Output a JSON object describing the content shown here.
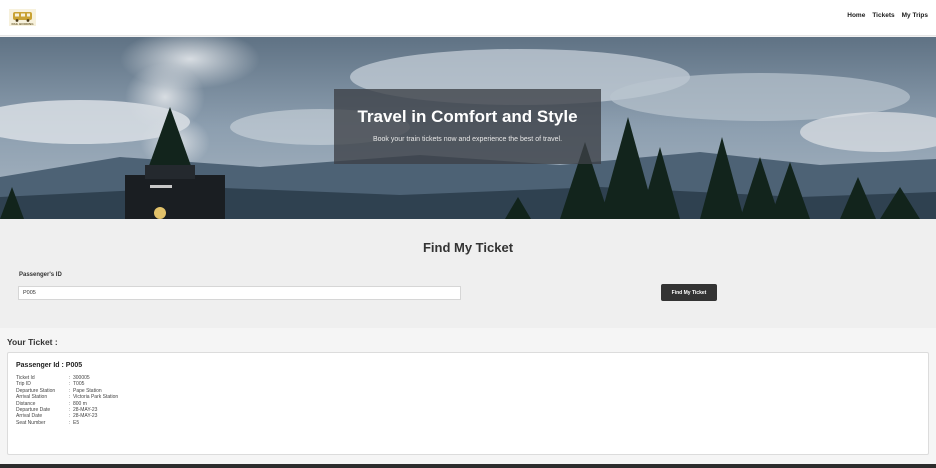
{
  "logo": {
    "text": "RAIL BOOKING",
    "icon": "train-logo-icon"
  },
  "nav": {
    "items": [
      "Home",
      "Tickets",
      "My Trips"
    ]
  },
  "hero": {
    "title": "Travel in Comfort and Style",
    "subtitle": "Book your train tickets now and experience the best of travel."
  },
  "find": {
    "title": "Find My Ticket",
    "label": "Passenger's ID",
    "input_value": "P005",
    "button_label": "Find My Ticket"
  },
  "ticket": {
    "heading": "Your Ticket :",
    "passenger_line": "Passenger Id : P005",
    "rows": [
      {
        "label": "Ticket Id",
        "value": "300005"
      },
      {
        "label": "Trip ID",
        "value": "T005"
      },
      {
        "label": "Departure Station",
        "value": "Pape Station"
      },
      {
        "label": "Arrival Station",
        "value": "Victoria Park Station"
      },
      {
        "label": "Distance",
        "value": "800 m"
      },
      {
        "label": "Departure Date",
        "value": "28-MAY-23"
      },
      {
        "label": "Arrival Date",
        "value": "28-MAY-23"
      },
      {
        "label": "Seat Number",
        "value": "E5"
      }
    ]
  },
  "colors": {
    "button": "#333333",
    "hero_overlay": "#3c4046",
    "background": "#efefef"
  }
}
